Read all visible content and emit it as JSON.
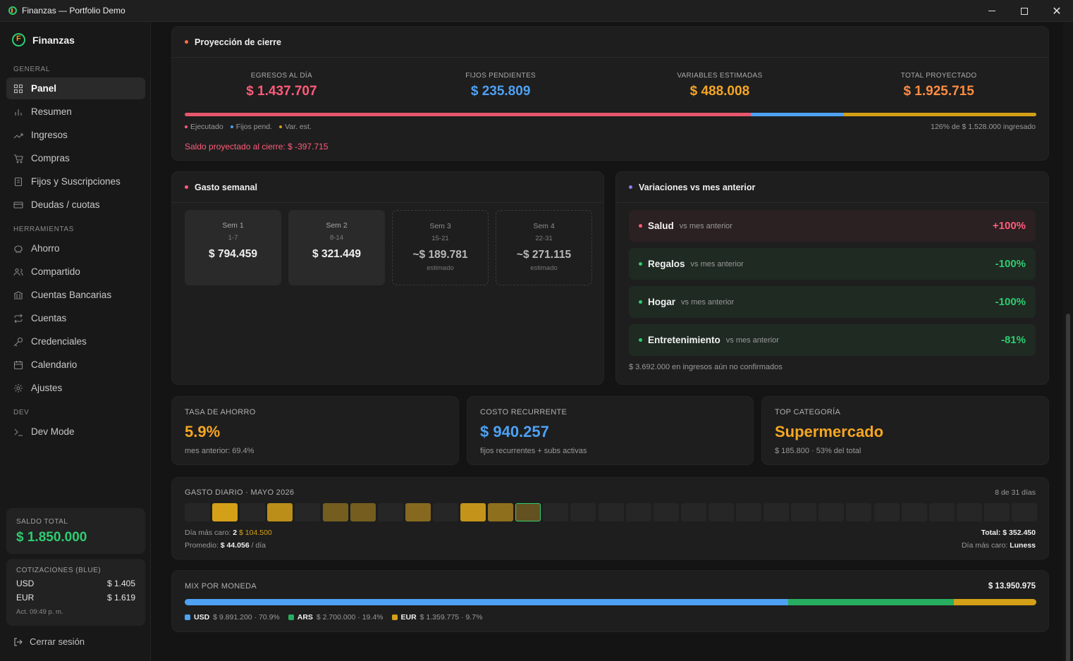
{
  "window": {
    "title": "Finanzas — Portfolio Demo"
  },
  "sidebar": {
    "brand": "Finanzas",
    "sections": {
      "general": "GENERAL",
      "tools": "HERRAMIENTAS",
      "dev": "DEV"
    },
    "items": [
      {
        "label": "Panel",
        "icon": "grid-icon",
        "active": true
      },
      {
        "label": "Resumen",
        "icon": "bar-chart-icon"
      },
      {
        "label": "Ingresos",
        "icon": "trend-up-icon"
      },
      {
        "label": "Compras",
        "icon": "cart-icon"
      },
      {
        "label": "Fijos y Suscripciones",
        "icon": "document-icon"
      },
      {
        "label": "Deudas / cuotas",
        "icon": "card-icon"
      },
      {
        "label": "Ahorro",
        "icon": "piggy-bank-icon"
      },
      {
        "label": "Compartido",
        "icon": "users-icon"
      },
      {
        "label": "Cuentas Bancarias",
        "icon": "bank-icon"
      },
      {
        "label": "Cuentas",
        "icon": "repeat-icon"
      },
      {
        "label": "Credenciales",
        "icon": "key-icon"
      },
      {
        "label": "Calendario",
        "icon": "calendar-icon"
      },
      {
        "label": "Ajustes",
        "icon": "gear-icon"
      },
      {
        "label": "Dev Mode",
        "icon": "terminal-icon"
      }
    ],
    "saldo": {
      "label": "SALDO TOTAL",
      "value": "$ 1.850.000"
    },
    "cotizaciones": {
      "label": "COTIZACIONES (BLUE)",
      "usd_label": "USD",
      "usd_value": "$ 1.405",
      "eur_label": "EUR",
      "eur_value": "$ 1.619",
      "updated": "Act. 09:49 p. m."
    },
    "logout": "Cerrar sesión"
  },
  "proyeccion": {
    "title": "Proyección de cierre",
    "stats": [
      {
        "label": "EGRESOS AL DÍA",
        "value": "$ 1.437.707",
        "color": "#ff5c7a"
      },
      {
        "label": "FIJOS PENDIENTES",
        "value": "$ 235.809",
        "color": "#4ea1f3"
      },
      {
        "label": "VARIABLES ESTIMADAS",
        "value": "$ 488.008",
        "color": "#f5a623"
      },
      {
        "label": "TOTAL PROYECTADO",
        "value": "$ 1.925.715",
        "color": "#ff8c42"
      }
    ],
    "bar_fractions": {
      "ejecutado": 0.665,
      "fijos": 0.109,
      "variables": 0.226
    },
    "legend": {
      "ejecutado": "Ejecutado",
      "fijos": "Fijos pend.",
      "variables": "Var. est."
    },
    "pct_note": "126% de $ 1.528.000 ingresado",
    "saldo_proyectado": "Saldo proyectado al cierre: $ -397.715"
  },
  "gasto_semanal": {
    "title": "Gasto semanal",
    "weeks": [
      {
        "label": "Sem 1",
        "range": "1-7",
        "value": "$ 794.459",
        "estimated": false
      },
      {
        "label": "Sem 2",
        "range": "8-14",
        "value": "$ 321.449",
        "estimated": false
      },
      {
        "label": "Sem 3",
        "range": "15-21",
        "value": "~$ 189.781",
        "estimated": true,
        "note": "estimado"
      },
      {
        "label": "Sem 4",
        "range": "22-31",
        "value": "~$ 271.115",
        "estimated": true,
        "note": "estimado"
      }
    ]
  },
  "variaciones": {
    "title": "Variaciones vs mes anterior",
    "items": [
      {
        "name": "Salud",
        "sub": "vs mes anterior",
        "value": "+100%",
        "color": "#ff5c7a",
        "bg": "#2b2022"
      },
      {
        "name": "Regalos",
        "sub": "vs mes anterior",
        "value": "-100%",
        "color": "#2ecc71",
        "bg": "#1f2a22"
      },
      {
        "name": "Hogar",
        "sub": "vs mes anterior",
        "value": "-100%",
        "color": "#2ecc71",
        "bg": "#1f2a22"
      },
      {
        "name": "Entretenimiento",
        "sub": "vs mes anterior",
        "value": "-81%",
        "color": "#2ecc71",
        "bg": "#1f2a22"
      }
    ],
    "footer": "$ 3.692.000 en ingresos aún no confirmados"
  },
  "kpis": [
    {
      "label": "TASA DE AHORRO",
      "value": "5.9%",
      "sub": "mes anterior: 69.4%",
      "color": "#f5a623"
    },
    {
      "label": "COSTO RECURRENTE",
      "value": "$ 940.257",
      "sub": "fijos recurrentes + subs activas",
      "color": "#4ea1f3"
    },
    {
      "label": "TOP CATEGORÍA",
      "value": "Supermercado",
      "sub": "$ 185.800 · 53% del total",
      "color": "#f5a623"
    }
  ],
  "gasto_diario": {
    "title": "GASTO DIARIO · MAYO 2026",
    "days_note": "8 de 31 días",
    "levels": [
      0,
      1,
      0,
      0.85,
      0,
      0.45,
      0.45,
      0,
      0.55,
      0,
      0.9,
      0.6,
      0.35,
      0,
      0,
      0,
      0,
      0,
      0,
      0,
      0,
      0,
      0,
      0,
      0,
      0,
      0,
      0,
      0,
      0,
      0
    ],
    "today_index": 12,
    "foot_left_1_label": "Día más caro:",
    "foot_left_1_day": "2",
    "foot_left_1_amount": "$ 104.500",
    "foot_left_2_label": "Promedio:",
    "foot_left_2_value": "$ 44.056",
    "foot_left_2_unit": "/ día",
    "foot_right_1": "Total: $ 352.450",
    "foot_right_2_label": "Día más caro:",
    "foot_right_2_value": "Luness"
  },
  "mix": {
    "title": "MIX POR MONEDA",
    "total": "$ 13.950.975",
    "items": [
      {
        "currency": "USD",
        "amount": "$ 9.891.200 · 70.9%",
        "fraction": 0.709,
        "color": "#4ea1f3"
      },
      {
        "currency": "ARS",
        "amount": "$ 2.700.000 · 19.4%",
        "fraction": 0.194,
        "color": "#27ae60"
      },
      {
        "currency": "EUR",
        "amount": "$ 1.359.775 · 9.7%",
        "fraction": 0.097,
        "color": "#d4a017"
      }
    ]
  },
  "colors": {
    "accent_green": "#2ecc71",
    "red": "#ff5c7a",
    "blue": "#4ea1f3",
    "amber": "#f5a623",
    "heat": "#d4a017"
  }
}
